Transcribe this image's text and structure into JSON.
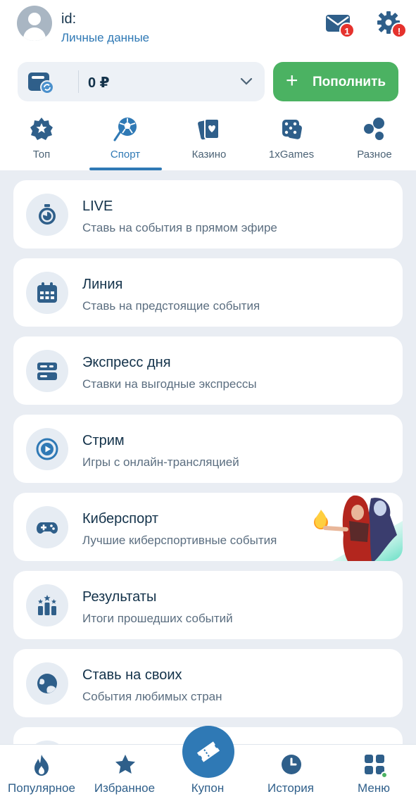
{
  "header": {
    "user_id_label": "id:",
    "personal_data_link": "Личные данные",
    "mail_badge": "1",
    "settings_badge": "!"
  },
  "balance": {
    "amount": "0 ₽",
    "topup_label": "Пополнить"
  },
  "tabs": [
    {
      "label": "Топ",
      "icon": "star-badge-icon"
    },
    {
      "label": "Спорт",
      "icon": "sport-ball-icon",
      "active": true
    },
    {
      "label": "Казино",
      "icon": "cards-icon"
    },
    {
      "label": "1xGames",
      "icon": "dice-icon"
    },
    {
      "label": "Разное",
      "icon": "bubbles-icon"
    }
  ],
  "cards": [
    {
      "title": "LIVE",
      "subtitle": "Ставь на события в прямом эфире",
      "icon": "stopwatch-icon"
    },
    {
      "title": "Линия",
      "subtitle": "Ставь на предстоящие события",
      "icon": "calendar-icon"
    },
    {
      "title": "Экспресс дня",
      "subtitle": "Ставки на выгодные экспрессы",
      "icon": "express-icon"
    },
    {
      "title": "Стрим",
      "subtitle": "Игры с онлайн-трансляцией",
      "icon": "play-icon"
    },
    {
      "title": "Киберспорт",
      "subtitle": "Лучшие киберспортивные события",
      "icon": "gamepad-icon"
    },
    {
      "title": "Результаты",
      "subtitle": "Итоги прошедших событий",
      "icon": "results-icon"
    },
    {
      "title": "Ставь на своих",
      "subtitle": "События любимых стран",
      "icon": "globe-icon"
    }
  ],
  "bottom_nav": [
    {
      "label": "Популярное",
      "icon": "flame-icon"
    },
    {
      "label": "Избранное",
      "icon": "star-icon"
    },
    {
      "label": "Купон",
      "icon": "ticket-icon"
    },
    {
      "label": "История",
      "icon": "clock-icon"
    },
    {
      "label": "Меню",
      "icon": "grid-icon"
    }
  ],
  "colors": {
    "accent": "#2f79b5",
    "topup_green": "#4bb262",
    "badge_red": "#e5322d",
    "background": "#e9edf3"
  }
}
